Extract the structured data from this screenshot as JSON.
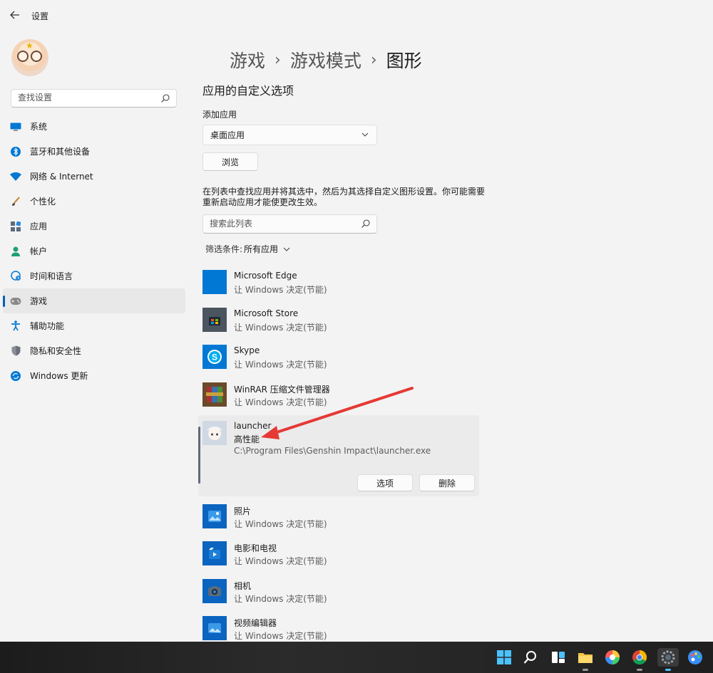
{
  "window": {
    "title": "设置"
  },
  "sidebar": {
    "search_placeholder": "查找设置",
    "items": [
      {
        "label": "系统",
        "icon": "monitor-icon"
      },
      {
        "label": "蓝牙和其他设备",
        "icon": "bluetooth-icon"
      },
      {
        "label": "网络 & Internet",
        "icon": "wifi-icon"
      },
      {
        "label": "个性化",
        "icon": "brush-icon"
      },
      {
        "label": "应用",
        "icon": "apps-icon"
      },
      {
        "label": "帐户",
        "icon": "person-icon"
      },
      {
        "label": "时间和语言",
        "icon": "globe-clock-icon"
      },
      {
        "label": "游戏",
        "icon": "gamepad-icon",
        "active": true
      },
      {
        "label": "辅助功能",
        "icon": "accessibility-icon"
      },
      {
        "label": "隐私和安全性",
        "icon": "shield-icon"
      },
      {
        "label": "Windows 更新",
        "icon": "update-icon"
      }
    ]
  },
  "breadcrumb": {
    "items": [
      "游戏",
      "游戏模式",
      "图形"
    ],
    "separator": "›"
  },
  "main": {
    "section_title": "应用的自定义选项",
    "add_app_label": "添加应用",
    "app_type_selected": "桌面应用",
    "browse_label": "浏览",
    "description": "在列表中查找应用并将其选中，然后为其选择自定义图形设置。你可能需要重新启动应用才能使更改生效。",
    "list_search_placeholder": "搜索此列表",
    "filter_label": "筛选条件:",
    "filter_value": "所有应用"
  },
  "apps": [
    {
      "name": "Microsoft Edge",
      "mode": "让 Windows 决定(节能)",
      "icon": "edge-icon"
    },
    {
      "name": "Microsoft Store",
      "mode": "让 Windows 决定(节能)",
      "icon": "store-icon"
    },
    {
      "name": "Skype",
      "mode": "让 Windows 决定(节能)",
      "icon": "skype-icon"
    },
    {
      "name": "WinRAR 压缩文件管理器",
      "mode": "让 Windows 决定(节能)",
      "icon": "winrar-icon"
    },
    {
      "name": "launcher",
      "mode": "高性能",
      "path": "C:\\Program Files\\Genshin Impact\\launcher.exe",
      "icon": "launcher-icon",
      "options_label": "选项",
      "remove_label": "删除"
    },
    {
      "name": "照片",
      "mode": "让 Windows 决定(节能)",
      "icon": "photos-icon"
    },
    {
      "name": "电影和电视",
      "mode": "让 Windows 决定(节能)",
      "icon": "movies-icon"
    },
    {
      "name": "相机",
      "mode": "让 Windows 决定(节能)",
      "icon": "camera-icon"
    },
    {
      "name": "视频编辑器",
      "mode": "让 Windows 决定(节能)",
      "icon": "video-editor-icon"
    }
  ],
  "taskbar": {
    "icons": [
      "start-icon",
      "search-icon",
      "task-view-icon",
      "file-explorer-icon",
      "colorful-app-icon",
      "chrome-icon",
      "settings-icon",
      "paint-icon"
    ]
  },
  "colors": {
    "accent": "#005fb8",
    "annotation_arrow": "#e53935"
  }
}
